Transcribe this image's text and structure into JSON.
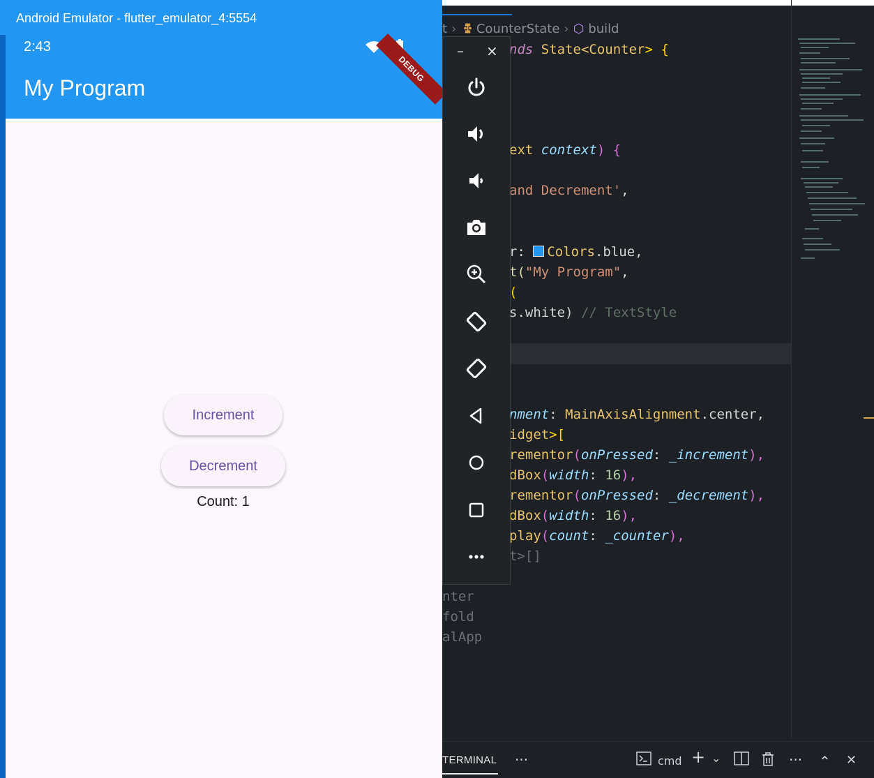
{
  "emulator": {
    "window_title": "Android Emulator - flutter_emulator_4:5554",
    "status_time": "2:43",
    "debug_banner": "DEBUG",
    "app_title": "My Program",
    "increment_label": "Increment",
    "decrement_label": "Decrement",
    "count_text": "Count: 1",
    "toolbar": {
      "minimize_label": "–",
      "close_label": "×",
      "buttons": [
        "power-icon",
        "volume-up-icon",
        "volume-down-icon",
        "camera-icon",
        "zoom-icon",
        "rotate-left-icon",
        "rotate-right-icon",
        "back-icon",
        "home-icon",
        "overview-icon",
        "more-icon"
      ]
    },
    "colors": {
      "app_bar": "#2196f3",
      "button_text": "#6750a4",
      "background": "#fdf7fe",
      "toolbar": "#202427"
    }
  },
  "editor": {
    "breadcrumb": {
      "fragment": "t",
      "class": "CounterState",
      "method": "build"
    },
    "code": {
      "l1_a": "nds ",
      "l1_b": "State",
      "l1_c": "<",
      "l1_d": "Counter",
      "l1_e": "> {",
      "l2_a": "ext ",
      "l2_b": "context",
      "l2_c": ") {",
      "l3_a": "and Decrement'",
      "l3_b": ",",
      "l4_a": "r: ",
      "l4_b": "Colors",
      "l4_c": ".blue,",
      "l5_a": "t(",
      "l5_b": "\"My Program\"",
      "l5_c": ",",
      "l6_a": "(",
      "l7_a": "s.white) ",
      "l7_b": "// TextStyle",
      "l8_a": "nment",
      "l8_b": ": ",
      "l8_c": "MainAxisAlignment",
      "l8_d": ".center,",
      "l9_a": "idget",
      "l9_b": ">[",
      "l10_a": "rementor",
      "l10_b": "(",
      "l10_c": "onPressed",
      "l10_d": ": ",
      "l10_e": "_increment",
      "l10_f": "),",
      "l11_a": "dBox",
      "l11_b": "(",
      "l11_c": "width",
      "l11_d": ": ",
      "l11_e": "16",
      "l11_f": "),",
      "l12_a": "rementor",
      "l12_b": "(",
      "l12_c": "onPressed",
      "l12_d": ": ",
      "l12_e": "_decrement",
      "l12_f": "),",
      "l13_a": "dBox",
      "l13_b": "(",
      "l13_c": "width",
      "l13_d": ": ",
      "l13_e": "16",
      "l13_f": "),",
      "l14_a": "play",
      "l14_b": "(",
      "l14_c": "count",
      "l14_d": ": ",
      "l14_e": "_counter",
      "l14_f": "),",
      "l15_a": "t>[]",
      "l16_a": "nter",
      "l17_a": "fold",
      "l18_a": "alApp"
    },
    "terminal": {
      "tab_label": "TERMINAL",
      "more_label": "···",
      "shell_label": "cmd",
      "add_label": "+",
      "dropdown_label": "⌄",
      "overflow_label": "···",
      "maximize_label": "⌃",
      "close_label": "✕"
    }
  }
}
